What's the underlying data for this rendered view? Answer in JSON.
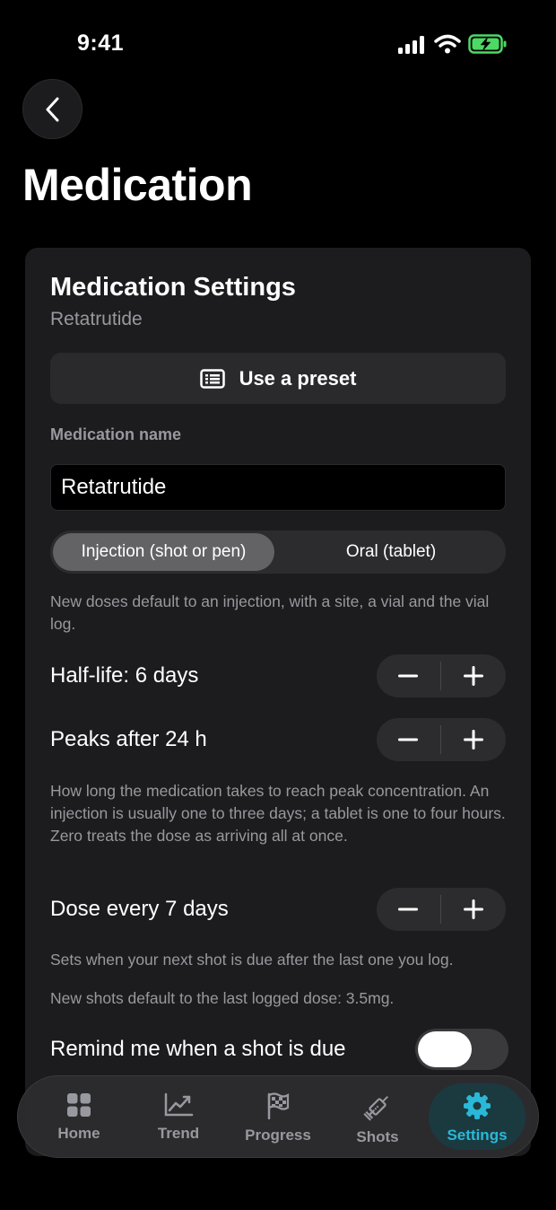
{
  "status_bar": {
    "time": "9:41"
  },
  "page": {
    "title": "Medication"
  },
  "card": {
    "title": "Medication Settings",
    "subtitle": "Retatrutide",
    "preset_button_label": "Use a preset",
    "name_field_label": "Medication name",
    "name_field_value": "Retatrutide",
    "route_options": [
      "Injection (shot or pen)",
      "Oral (tablet)"
    ],
    "route_selected": "Injection (shot or pen)",
    "route_helper": "New doses default to an injection, with a site, a vial and the vial log.",
    "half_life_label": "Half-life: 6 days",
    "peak_label": "Peaks after 24 h",
    "peak_helper": "How long the medication takes to reach peak concentration. An injection is usually one to three days; a tablet is one to four hours. Zero treats the dose as arriving all at once.",
    "dose_interval_label": "Dose every 7 days",
    "dose_interval_helper": "Sets when your next shot is due after the last one you log.",
    "default_dose_note": "New shots default to the last logged dose: 3.5mg.",
    "reminder_label": "Remind me when a shot is due",
    "reminder_enabled": false
  },
  "tabbar": {
    "tabs": [
      {
        "label": "Home",
        "icon": "grid-icon"
      },
      {
        "label": "Trend",
        "icon": "chart-icon"
      },
      {
        "label": "Progress",
        "icon": "flag-icon"
      },
      {
        "label": "Shots",
        "icon": "syringe-icon"
      },
      {
        "label": "Settings",
        "icon": "gear-icon"
      }
    ],
    "active": "Settings"
  },
  "colors": {
    "background": "#000000",
    "card": "#1c1c1e",
    "accent": "#2ab8d8",
    "battery": "#4cd964"
  }
}
